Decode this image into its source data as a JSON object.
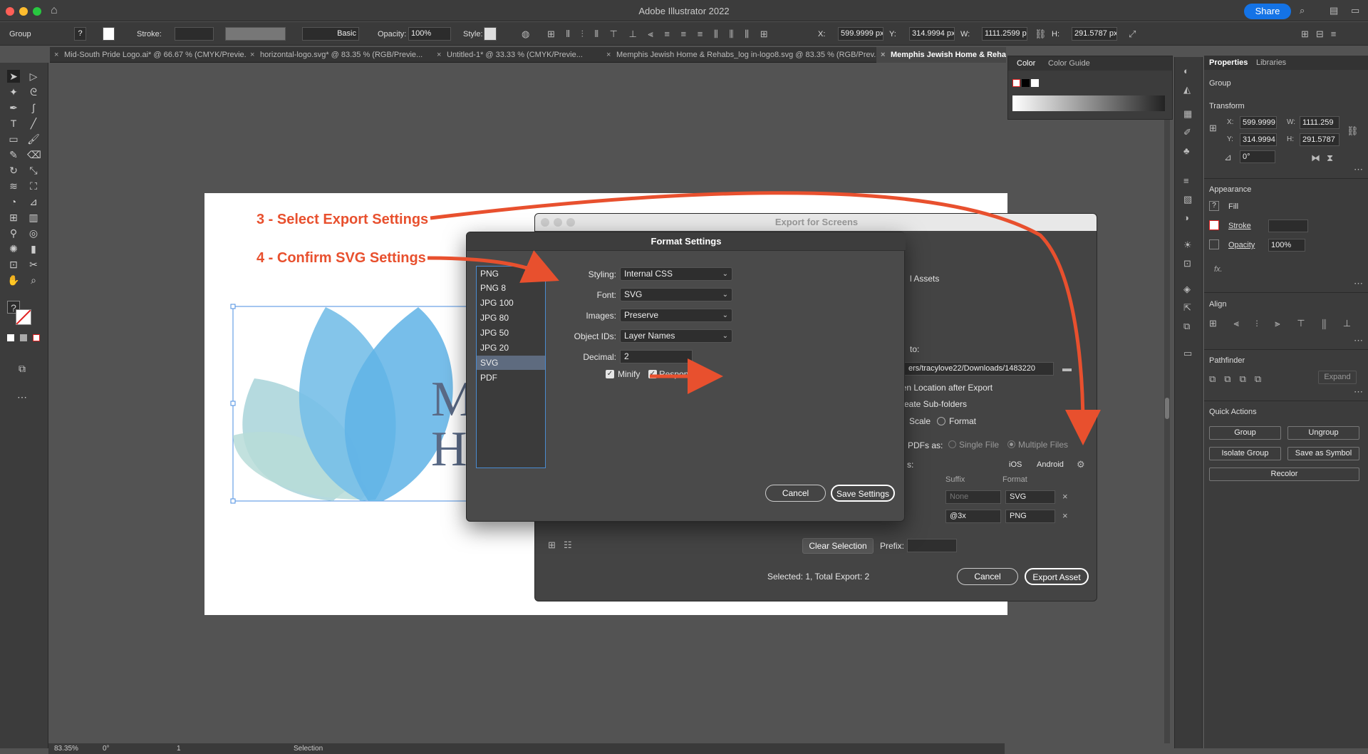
{
  "app": {
    "title": "Adobe Illustrator 2022",
    "share_label": "Share"
  },
  "control_bar": {
    "selection_type": "Group",
    "stroke_label": "Stroke:",
    "stroke_profile": "Basic",
    "opacity_label": "Opacity:",
    "opacity_value": "100%",
    "style_label": "Style:",
    "x_label": "X:",
    "x_value": "599.9999 px",
    "y_label": "Y:",
    "y_value": "314.9994 px",
    "w_label": "W:",
    "w_value": "1111.2599 px",
    "h_label": "H:",
    "h_value": "291.5787 px"
  },
  "doc_tabs": [
    "Mid-South Pride Logo.ai* @ 66.67 % (CMYK/Previe...",
    "horizontal-logo.svg* @ 83.35 % (RGB/Previe...",
    "Untitled-1* @ 33.33 % (CMYK/Previe...",
    "Memphis Jewish Home & Rehabs_log in-logo8.svg @ 83.35 % (RGB/Prev...",
    "Memphis Jewish Home & Rehabs_log in"
  ],
  "annotations": {
    "step3": "3 - Select Export Settings",
    "step4": "4 - Confirm SVG Settings"
  },
  "artboard": {
    "logo_letter_1": "M",
    "logo_letter_2": "H"
  },
  "color_panel": {
    "tab_color": "Color",
    "tab_guide": "Color Guide"
  },
  "properties": {
    "tab_properties": "Properties",
    "tab_libraries": "Libraries",
    "selection": "Group",
    "transform_title": "Transform",
    "x_label": "X:",
    "x_value": "599.9999",
    "y_label": "Y:",
    "y_value": "314.9994",
    "w_label": "W:",
    "w_value": "1111.259",
    "h_label": "H:",
    "h_value": "291.5787",
    "angle_value": "0°",
    "appearance_title": "Appearance",
    "fill_label": "Fill",
    "stroke_label": "Stroke",
    "opacity_label": "Opacity",
    "opacity_value": "100%",
    "fx_label": "fx.",
    "align_title": "Align",
    "pathfinder_title": "Pathfinder",
    "expand_label": "Expand",
    "quick_actions_title": "Quick Actions",
    "group_btn": "Group",
    "ungroup_btn": "Ungroup",
    "isolate_btn": "Isolate Group",
    "symbol_btn": "Save as Symbol",
    "recolor_btn": "Recolor"
  },
  "export_for_screens": {
    "title": "Export for Screens",
    "assets_label": "l Assets",
    "export_to_label": "to:",
    "path_value": "ers/tracylove22/Downloads/1483220",
    "open_location": "pen Location after Export",
    "create_subfolders": "reate Sub-folders",
    "scale_label": "Scale",
    "format_label": "Format",
    "pdfs_as_label": "PDFs as:",
    "single_file": "Single File",
    "multiple_files": "Multiple Files",
    "formats_label": "s:",
    "ios": "iOS",
    "android": "Android",
    "col_suffix": "Suffix",
    "col_format": "Format",
    "rows": [
      {
        "suffix": "None",
        "format": "SVG"
      },
      {
        "suffix": "@3x",
        "format": "PNG"
      }
    ],
    "clear_selection": "Clear Selection",
    "prefix_label": "Prefix:",
    "selected_status": "Selected: 1, Total Export: 2",
    "cancel": "Cancel",
    "export_asset": "Export Asset"
  },
  "format_settings": {
    "title": "Format Settings",
    "formats": [
      "PNG",
      "PNG 8",
      "JPG 100",
      "JPG 80",
      "JPG 50",
      "JPG 20",
      "SVG",
      "PDF"
    ],
    "selected_format": "SVG",
    "styling_label": "Styling:",
    "styling_value": "Internal CSS",
    "font_label": "Font:",
    "font_value": "SVG",
    "images_label": "Images:",
    "images_value": "Preserve",
    "object_ids_label": "Object IDs:",
    "object_ids_value": "Layer Names",
    "decimal_label": "Decimal:",
    "decimal_value": "2",
    "minify_label": "Minify",
    "responsive_label": "Respons",
    "cancel": "Cancel",
    "save": "Save Settings"
  },
  "status_bar": {
    "zoom": "83.35%",
    "rotation": "0°",
    "artboard_num": "1",
    "tool": "Selection"
  },
  "colors": {
    "accent": "#1473e6",
    "annotation": "#e8502e",
    "leaf_blue": "#6fb8e8",
    "leaf_teal": "#7cc4c4"
  }
}
